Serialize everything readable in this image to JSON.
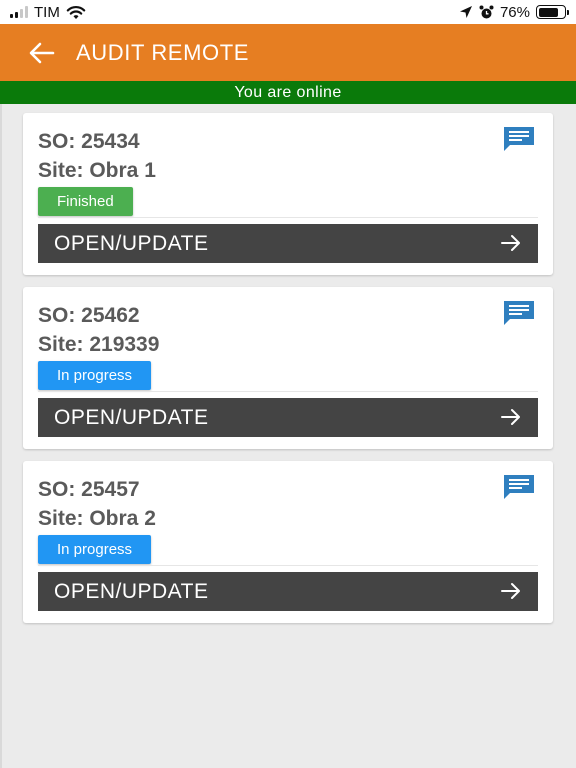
{
  "status_bar": {
    "carrier": "TIM",
    "battery_percent": "76%",
    "battery_level": 0.76
  },
  "header": {
    "title": "AUDIT REMOTE"
  },
  "connection": {
    "text": "You are online"
  },
  "orders": [
    {
      "so": "SO: 25434",
      "site": "Site: Obra 1",
      "status": "Finished",
      "button": "OPEN/UPDATE"
    },
    {
      "so": "SO: 25462",
      "site": "Site: 219339",
      "status": "In progress",
      "button": "OPEN/UPDATE"
    },
    {
      "so": "SO: 25457",
      "site": "Site: Obra 2",
      "status": "In progress",
      "button": "OPEN/UPDATE"
    }
  ],
  "colors": {
    "app_bar": "#e67e22",
    "online": "#0a7a0a",
    "finished": "#4caf50",
    "in_progress": "#2196f3",
    "button": "#444444",
    "chat_icon": "#2f7fbf"
  },
  "icons": {
    "back": "arrow-left-icon",
    "comment": "chat-icon",
    "open": "arrow-right-icon"
  }
}
